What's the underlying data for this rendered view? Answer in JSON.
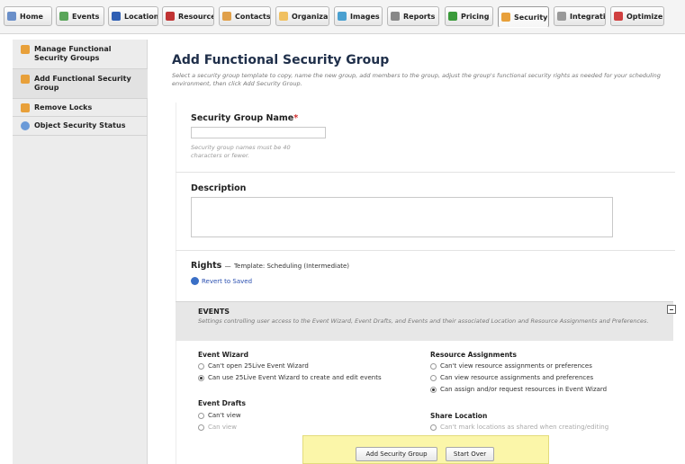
{
  "tabs": [
    {
      "label": "Home",
      "icon": "home-icon",
      "color": "#6a8fc9"
    },
    {
      "label": "Events",
      "icon": "events-icon",
      "color": "#5aa55a"
    },
    {
      "label": "Location",
      "icon": "location-icon",
      "color": "#2f5fb3"
    },
    {
      "label": "Resource",
      "icon": "resource-icon",
      "color": "#c03333"
    },
    {
      "label": "Contacts",
      "icon": "contacts-icon",
      "color": "#e0a04a"
    },
    {
      "label": "Organiza",
      "icon": "organizations-icon",
      "color": "#f0c060"
    },
    {
      "label": "Images",
      "icon": "images-icon",
      "color": "#4aa0d0"
    },
    {
      "label": "Reports",
      "icon": "reports-icon",
      "color": "#888888"
    },
    {
      "label": "Pricing",
      "icon": "pricing-icon",
      "color": "#3a9a3a"
    },
    {
      "label": "Security",
      "icon": "security-icon",
      "color": "#e8a03a"
    },
    {
      "label": "Integrati",
      "icon": "integrations-icon",
      "color": "#999999"
    },
    {
      "label": "Optimize",
      "icon": "optimize-icon",
      "color": "#d04040"
    }
  ],
  "sidebar": {
    "items": [
      {
        "label": "Manage Functional Security Groups",
        "icon": "group-icon",
        "color": "#e8a03a"
      },
      {
        "label": "Add Functional Security Group",
        "icon": "group-add-icon",
        "color": "#e8a03a"
      },
      {
        "label": "Remove Locks",
        "icon": "lock-icon",
        "color": "#e8a03a"
      },
      {
        "label": "Object Security Status",
        "icon": "status-icon",
        "color": "#6a9ad8"
      }
    ]
  },
  "main": {
    "title": "Add Functional Security Group",
    "subtitle": "Select a security group template to copy, name the new group, add members to the group, adjust the group's functional security rights as needed for your scheduling environment, then click Add Security Group.",
    "name_label": "Security Group Name",
    "required_mark": "*",
    "name_value": "",
    "name_hint": "Security group names must be 40 characters or fewer.",
    "description_label": "Description",
    "description_value": "",
    "rights_label": "Rights",
    "rights_dash": "—",
    "rights_template": "Template: Scheduling (Intermediate)",
    "revert_label": "Revert to Saved",
    "events": {
      "title": "EVENTS",
      "description": "Settings controlling user access to the Event Wizard, Event Drafts, and Events and their associated Location and Resource Assignments and Preferences.",
      "groups": [
        {
          "title": "Event Wizard",
          "options": [
            {
              "label": "Can't open 25Live Event Wizard",
              "selected": false
            },
            {
              "label": "Can use 25Live Event Wizard to create and edit events",
              "selected": true
            }
          ]
        },
        {
          "title": "Event Drafts",
          "options": [
            {
              "label": "Can't view",
              "selected": false
            },
            {
              "label": "Can view",
              "selected": false
            }
          ]
        },
        {
          "title": "Resource Assignments",
          "options": [
            {
              "label": "Can't view resource assignments or preferences",
              "selected": false
            },
            {
              "label": "Can view resource assignments and preferences",
              "selected": false
            },
            {
              "label": "Can assign and/or request resources in Event Wizard",
              "selected": true
            }
          ]
        },
        {
          "title": "Share Location",
          "options": [
            {
              "label": "Can't mark locations as shared when creating/editing",
              "selected": false
            }
          ]
        }
      ]
    }
  },
  "actions": {
    "add_label": "Add Security Group",
    "start_over_label": "Start Over"
  }
}
